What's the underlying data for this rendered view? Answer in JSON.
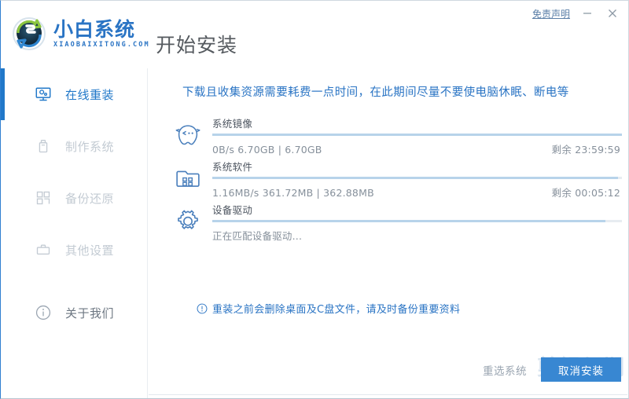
{
  "window": {
    "disclaimer_label": "免责声明",
    "minimize_icon": "minimize-icon",
    "close_icon": "close-icon"
  },
  "brand": {
    "logo_icon": "refresh-circle-logo-icon",
    "name_cn": "小白系统",
    "name_en": "XIAOBAIXITONG.COM"
  },
  "header": {
    "title": "开始安装"
  },
  "sidebar": {
    "items": [
      {
        "label": "在线重装",
        "icon": "monitor-icon",
        "active": true,
        "id": "online-reinstall"
      },
      {
        "label": "制作系统",
        "icon": "usb-drive-icon",
        "active": false,
        "id": "make-system"
      },
      {
        "label": "备份还原",
        "icon": "blocks-icon",
        "active": false,
        "id": "backup-restore"
      },
      {
        "label": "其他设置",
        "icon": "toolbox-icon",
        "active": false,
        "id": "other-settings"
      },
      {
        "label": "关于我们",
        "icon": "info-circle-icon",
        "active": false,
        "id": "about-us"
      }
    ]
  },
  "main": {
    "notice": "下载且收集资源需要耗费一点时间，在此期间尽量不要使电脑休眠、断电等",
    "tasks": [
      {
        "name": "系统镜像",
        "icon": "ghost-face-icon",
        "progress_percent": 100,
        "speed": "0B/s",
        "downloaded": "6.70GB",
        "total": "6.70GB",
        "meta_left": "0B/s 6.70GB | 6.70GB",
        "meta_right": "剩余 23:59:59",
        "remaining_label": "剩余",
        "remaining_time": "23:59:59"
      },
      {
        "name": "系统软件",
        "icon": "folder-grid-icon",
        "progress_percent": 99,
        "speed": "1.16MB/s",
        "downloaded": "361.72MB",
        "total": "362.88MB",
        "meta_left": "1.16MB/s 361.72MB | 362.88MB",
        "meta_right": "剩余 00:05:12",
        "remaining_label": "剩余",
        "remaining_time": "00:05:12"
      },
      {
        "name": "设备驱动",
        "icon": "gear-icon",
        "progress_percent": 96,
        "meta_left": "正在匹配设备驱动...",
        "meta_right": ""
      }
    ],
    "warning": {
      "icon": "exclamation-circle-icon",
      "text": "重装之前会删除桌面及C盘文件，请及时备份重要资料"
    }
  },
  "footer": {
    "reselect_label": "重选系统",
    "cancel_label": "取消安装",
    "watermark": "剪辑与期"
  },
  "colors": {
    "accent": "#2178c9",
    "primary_button": "#3887d2",
    "link_blue": "#2a74c4",
    "muted_text": "#c3cbd3",
    "bar_fill": "#b7d3ea",
    "bar_track": "#e7ecf1"
  }
}
